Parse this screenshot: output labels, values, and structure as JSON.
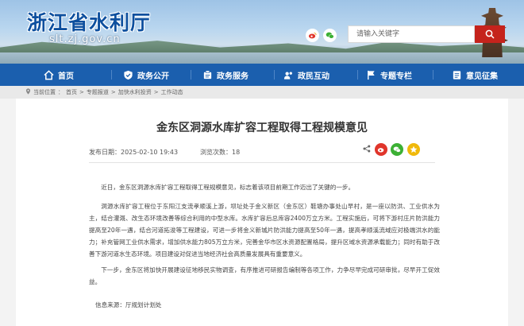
{
  "header": {
    "site_title": "浙江省水利厅",
    "site_domain": "slt.zj.gov.cn",
    "search_placeholder": "请输入关键字",
    "icons": [
      "weibo-icon",
      "wechat-icon",
      "search-icon"
    ]
  },
  "nav": {
    "items": [
      {
        "label": "首页",
        "icon": "home-icon"
      },
      {
        "label": "政务公开",
        "icon": "shield-icon"
      },
      {
        "label": "政务服务",
        "icon": "service-icon"
      },
      {
        "label": "政民互动",
        "icon": "interaction-icon"
      },
      {
        "label": "专题专栏",
        "icon": "flag-icon"
      },
      {
        "label": "意见征集",
        "icon": "survey-icon"
      }
    ]
  },
  "breadcrumb": {
    "current_label": "当前位置",
    "items": [
      "首页",
      "专题报道",
      "加快水利投资",
      "工作动态"
    ]
  },
  "article": {
    "title": "金东区洞源水库扩容工程取得工程规模意见",
    "publish_label": "发布日期：",
    "publish_date": "2025-02-10 19:43",
    "views_label": "浏览次数：",
    "views": "18",
    "paragraphs": [
      "近日，金东区洞源水库扩容工程取得工程规模意见，标志着该项目前期工作迈出了关键的一步。",
      "洞源水库扩容工程位于东阳江支流孝顺溪上游，坝址处于金义新区（金东区）鞋塘办事处山早村，是一座以防洪、工业供水为主，结合灌溉、改生态环境改善等综合利用的中型水库。水库扩容后总库容2400万立方米。工程实施后，可将下游村庄片防洪能力提高至20年一遇，结合河道拓浚等工程建设，可进一步将金义新城片防洪能力提高至50年一遇，提高孝顺溪流域应对极端洪水的能力；补充管网工业供水需求，增加供水能力805万立方米，完善金华市区水资源配置格局，提升区域水资源承载能力；同时有助于改善下游河道水生态环境。项目建设对促进当地经济社会高质量发展具有重要意义。",
      "下一步，金东区将加快开展建设征地移民实物调查，有序推进可研报告编制等各项工作，力争尽早完成可研审批，尽早开工促效益。"
    ],
    "source_label": "信息来源：",
    "source": "厅规划计划处"
  },
  "colors": {
    "nav_blue": "#1b5fae",
    "search_red": "#c5231c",
    "weibo_red": "#e0352b",
    "wechat_green": "#3cb034",
    "qzone_yellow": "#f0b90b"
  }
}
